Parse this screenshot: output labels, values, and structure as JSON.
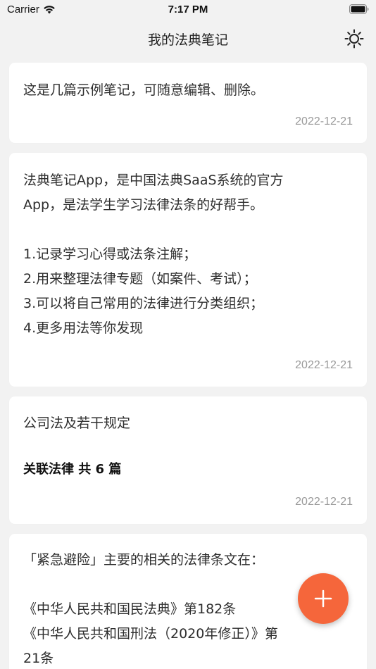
{
  "status_bar": {
    "carrier": "Carrier",
    "time": "7:17 PM",
    "wifi_icon": "wifi-icon",
    "battery_icon": "battery-icon"
  },
  "nav": {
    "title": "我的法典笔记",
    "settings_icon": "sun-icon"
  },
  "notes": [
    {
      "text": "这是几篇示例笔记，可随意编辑、删除。",
      "date": "2022-12-21"
    },
    {
      "text": "法典笔记App，是中国法典SaaS系统的官方\nApp，是法学生学习法律法条的好帮手。\n\n1.记录学习心得或法条注解；\n2.用来整理法律专题（如案件、考试）；\n3.可以将自己常用的法律进行分类组织；\n4.更多用法等你发现",
      "date": "2022-12-21"
    },
    {
      "text": "公司法及若干规定",
      "related": "关联法律 共 6 篇",
      "date": "2022-12-21"
    },
    {
      "text": "「紧急避险」主要的相关的法律条文在：\n\n《中华人民共和国民法典》第182条\n《中华人民共和国刑法（2020年修正）》第\n21条"
    }
  ],
  "fab": {
    "icon": "plus-icon",
    "color": "#f5663b"
  },
  "colors": {
    "background": "#f2f2f2",
    "card": "#ffffff",
    "date": "#9a9a9a",
    "accent": "#f5663b"
  }
}
